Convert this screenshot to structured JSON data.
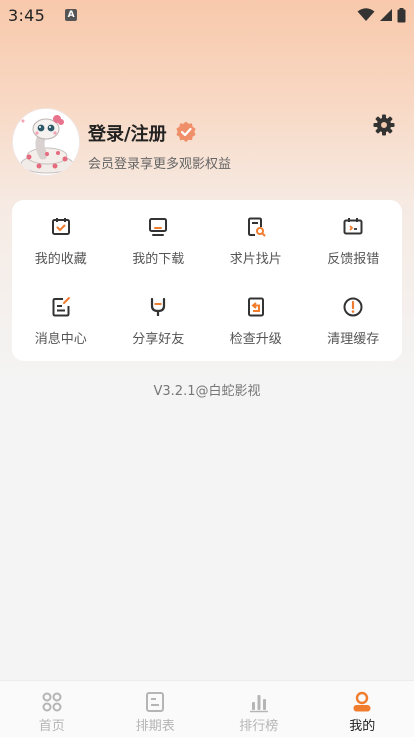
{
  "status_bar": {
    "time": "3:45",
    "notification_icon": "A"
  },
  "profile": {
    "title": "登录/注册",
    "subtitle": "会员登录享更多观影权益",
    "avatar_icon": "snake-avatar-icon",
    "badge_icon": "verified-badge-icon",
    "settings_icon": "gear-icon"
  },
  "grid": {
    "items": [
      {
        "label": "我的收藏",
        "icon": "favorites-icon"
      },
      {
        "label": "我的下载",
        "icon": "download-icon"
      },
      {
        "label": "求片找片",
        "icon": "search-film-icon"
      },
      {
        "label": "反馈报错",
        "icon": "feedback-icon"
      },
      {
        "label": "消息中心",
        "icon": "message-icon"
      },
      {
        "label": "分享好友",
        "icon": "share-icon"
      },
      {
        "label": "检查升级",
        "icon": "upgrade-icon"
      },
      {
        "label": "清理缓存",
        "icon": "clear-cache-icon"
      }
    ]
  },
  "version": "V3.2.1@白蛇影视",
  "tabbar": {
    "tabs": [
      {
        "label": "首页",
        "icon": "home-icon",
        "active": false
      },
      {
        "label": "排期表",
        "icon": "schedule-icon",
        "active": false
      },
      {
        "label": "排行榜",
        "icon": "ranking-icon",
        "active": false
      },
      {
        "label": "我的",
        "icon": "profile-icon",
        "active": true
      }
    ]
  },
  "colors": {
    "accent": "#f07c2e",
    "icon_dark": "#333333",
    "tab_inactive": "#b5b5b5"
  }
}
